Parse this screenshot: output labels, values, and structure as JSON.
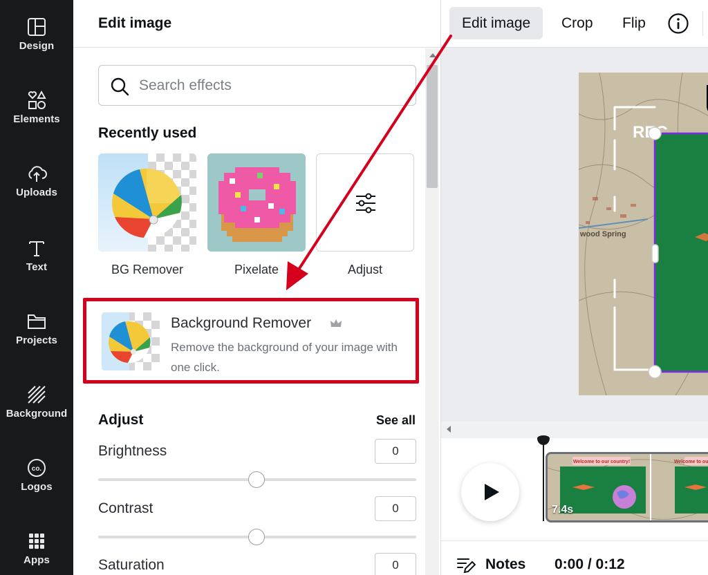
{
  "sidebar": {
    "items": [
      {
        "label": "Design",
        "icon": "design-icon"
      },
      {
        "label": "Elements",
        "icon": "elements-icon"
      },
      {
        "label": "Uploads",
        "icon": "uploads-icon"
      },
      {
        "label": "Text",
        "icon": "text-icon"
      },
      {
        "label": "Projects",
        "icon": "folder-icon"
      },
      {
        "label": "Background",
        "icon": "background-icon"
      },
      {
        "label": "Logos",
        "icon": "logos-icon"
      },
      {
        "label": "Apps",
        "icon": "apps-icon"
      }
    ]
  },
  "panel": {
    "title": "Edit image",
    "search": {
      "placeholder": "Search effects",
      "value": ""
    },
    "recently_used": {
      "title": "Recently used",
      "items": [
        {
          "label": "BG Remover"
        },
        {
          "label": "Pixelate"
        },
        {
          "label": "Adjust"
        }
      ]
    },
    "feature": {
      "title": "Background Remover",
      "badge_icon": "crown-icon",
      "description": "Remove the background of your image with one click."
    },
    "adjust": {
      "title": "Adjust",
      "see_all": "See all",
      "sliders": [
        {
          "label": "Brightness",
          "value": "0"
        },
        {
          "label": "Contrast",
          "value": "0"
        },
        {
          "label": "Saturation",
          "value": "0"
        }
      ]
    }
  },
  "toolbar": {
    "buttons": [
      "Edit image",
      "Crop",
      "Flip"
    ],
    "info_icon": "info-icon"
  },
  "canvas": {
    "overlay_text": "REC"
  },
  "timeline": {
    "clip_duration": "7.4s",
    "clip_banner": "Welcome to our country!"
  },
  "footer": {
    "notes_label": "Notes",
    "timecode": "0:00 / 0:12"
  },
  "colors": {
    "rail_bg": "#18191b",
    "highlight_red": "#d4001c",
    "green_element": "#1a8041",
    "selection_purple": "#7d2ae8"
  }
}
